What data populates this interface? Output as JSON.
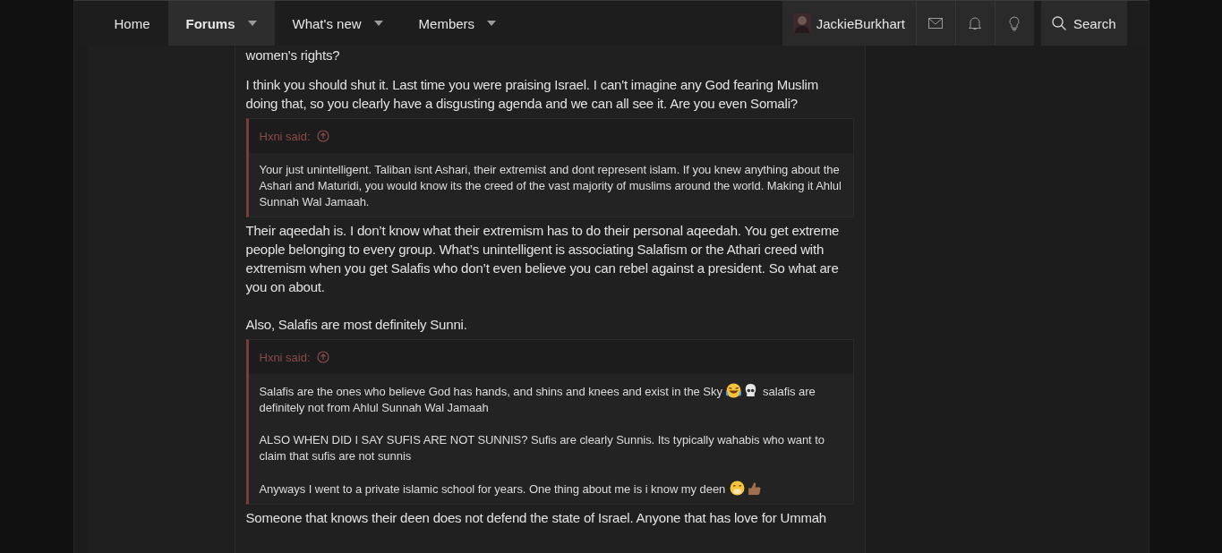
{
  "navbar": {
    "tabs": [
      {
        "label": "Home",
        "selected": false,
        "menu": false
      },
      {
        "label": "Forums",
        "selected": true,
        "menu": true
      },
      {
        "label": "What's new",
        "selected": false,
        "menu": true
      },
      {
        "label": "Members",
        "selected": false,
        "menu": true
      }
    ],
    "user": {
      "name": "JackieBurkhart"
    },
    "search": {
      "label": "Search"
    }
  },
  "post": {
    "blocks": [
      {
        "kind": "text",
        "text": "women's rights?"
      },
      {
        "kind": "text",
        "text": "I think you should shut it. Last time you were praising Israel. I can't imagine any God fearing Muslim doing that, so you clearly have a disgusting agenda and we can all see it. Are you even Somali?"
      },
      {
        "kind": "quote",
        "author": "Hxni said:",
        "paragraphs": [
          [
            {
              "kind": "text",
              "text": "Your just unintelligent. Taliban isnt Ashari, their extremist and dont represent islam. If you knew anything about the Ashari and Maturidi, you would know its the creed of the vast majority of muslims around the world. Making it Ahlul Sunnah Wal Jamaah."
            }
          ]
        ]
      },
      {
        "kind": "text",
        "text": "Their aqeedah is. I don’t know what their extremism has to do their personal aqeedah. You get extreme people belonging to every group. What’s unintelligent is associating Salafism or the Athari creed with extremism when you get Salafis who don’t even believe you can rebel against a president. So what are you on about."
      },
      {
        "kind": "text",
        "text": "Also, Salafis are most definitely Sunni."
      },
      {
        "kind": "quote",
        "author": "Hxni said:",
        "paragraphs": [
          [
            {
              "kind": "text",
              "text": "Salafis are the ones who believe God has hands, and shins and knees and exist in the Sky "
            },
            {
              "kind": "emoji"
            },
            {
              "kind": "emoji"
            },
            {
              "kind": "text",
              "text": " salafis are definitely not from Ahlul Sunnah Wal Jamaah"
            }
          ],
          [
            {
              "kind": "text",
              "text": "ALSO WHEN DID I SAY SUFIS ARE NOT SUNNIS? Sufis are clearly Sunnis. Its typically wahabis who want to claim that sufis are not sunnis"
            }
          ],
          [
            {
              "kind": "text",
              "text": "Anyways I went to a private islamic school for years. One thing about me is i know my deen "
            },
            {
              "kind": "emoji"
            },
            {
              "kind": "emoji"
            }
          ]
        ]
      },
      {
        "kind": "text",
        "text": "Someone that knows their deen does not defend the state of Israel. Anyone that has love for Ummah"
      }
    ]
  }
}
